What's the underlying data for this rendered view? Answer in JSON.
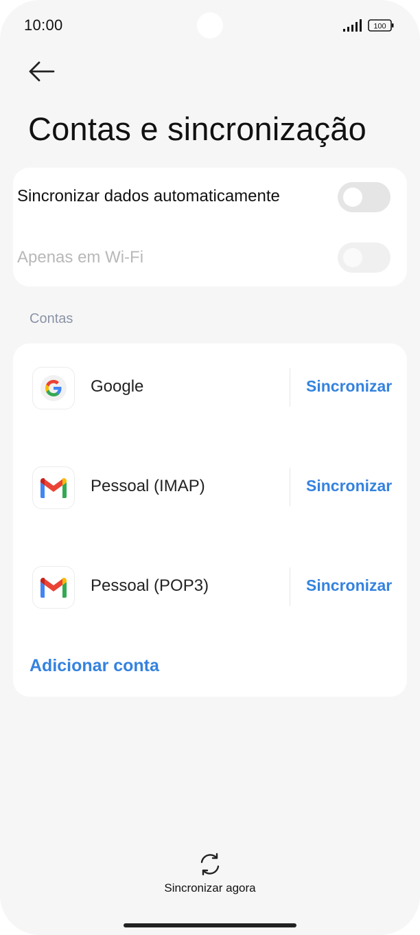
{
  "status_bar": {
    "time": "10:00",
    "battery_level": "100"
  },
  "header": {
    "back_icon": "arrow-left-icon",
    "title": "Contas e sincronização"
  },
  "sync_settings": {
    "auto_sync": {
      "label": "Sincronizar dados automaticamente",
      "enabled": false
    },
    "wifi_only": {
      "label": "Apenas em Wi-Fi",
      "enabled": false,
      "disabled": true
    }
  },
  "accounts_section": {
    "title": "Contas",
    "items": [
      {
        "name": "Google",
        "icon": "google-icon",
        "action": "Sincronizar"
      },
      {
        "name": "Pessoal (IMAP)",
        "icon": "gmail-icon",
        "action": "Sincronizar"
      },
      {
        "name": "Pessoal (POP3)",
        "icon": "gmail-icon",
        "action": "Sincronizar"
      }
    ],
    "add_account": "Adicionar conta"
  },
  "footer": {
    "sync_now_icon": "sync-icon",
    "sync_now_label": "Sincronizar agora"
  },
  "colors": {
    "accent": "#3482df",
    "background": "#f6f6f6",
    "card": "#ffffff",
    "section_header": "#8a93a6"
  }
}
